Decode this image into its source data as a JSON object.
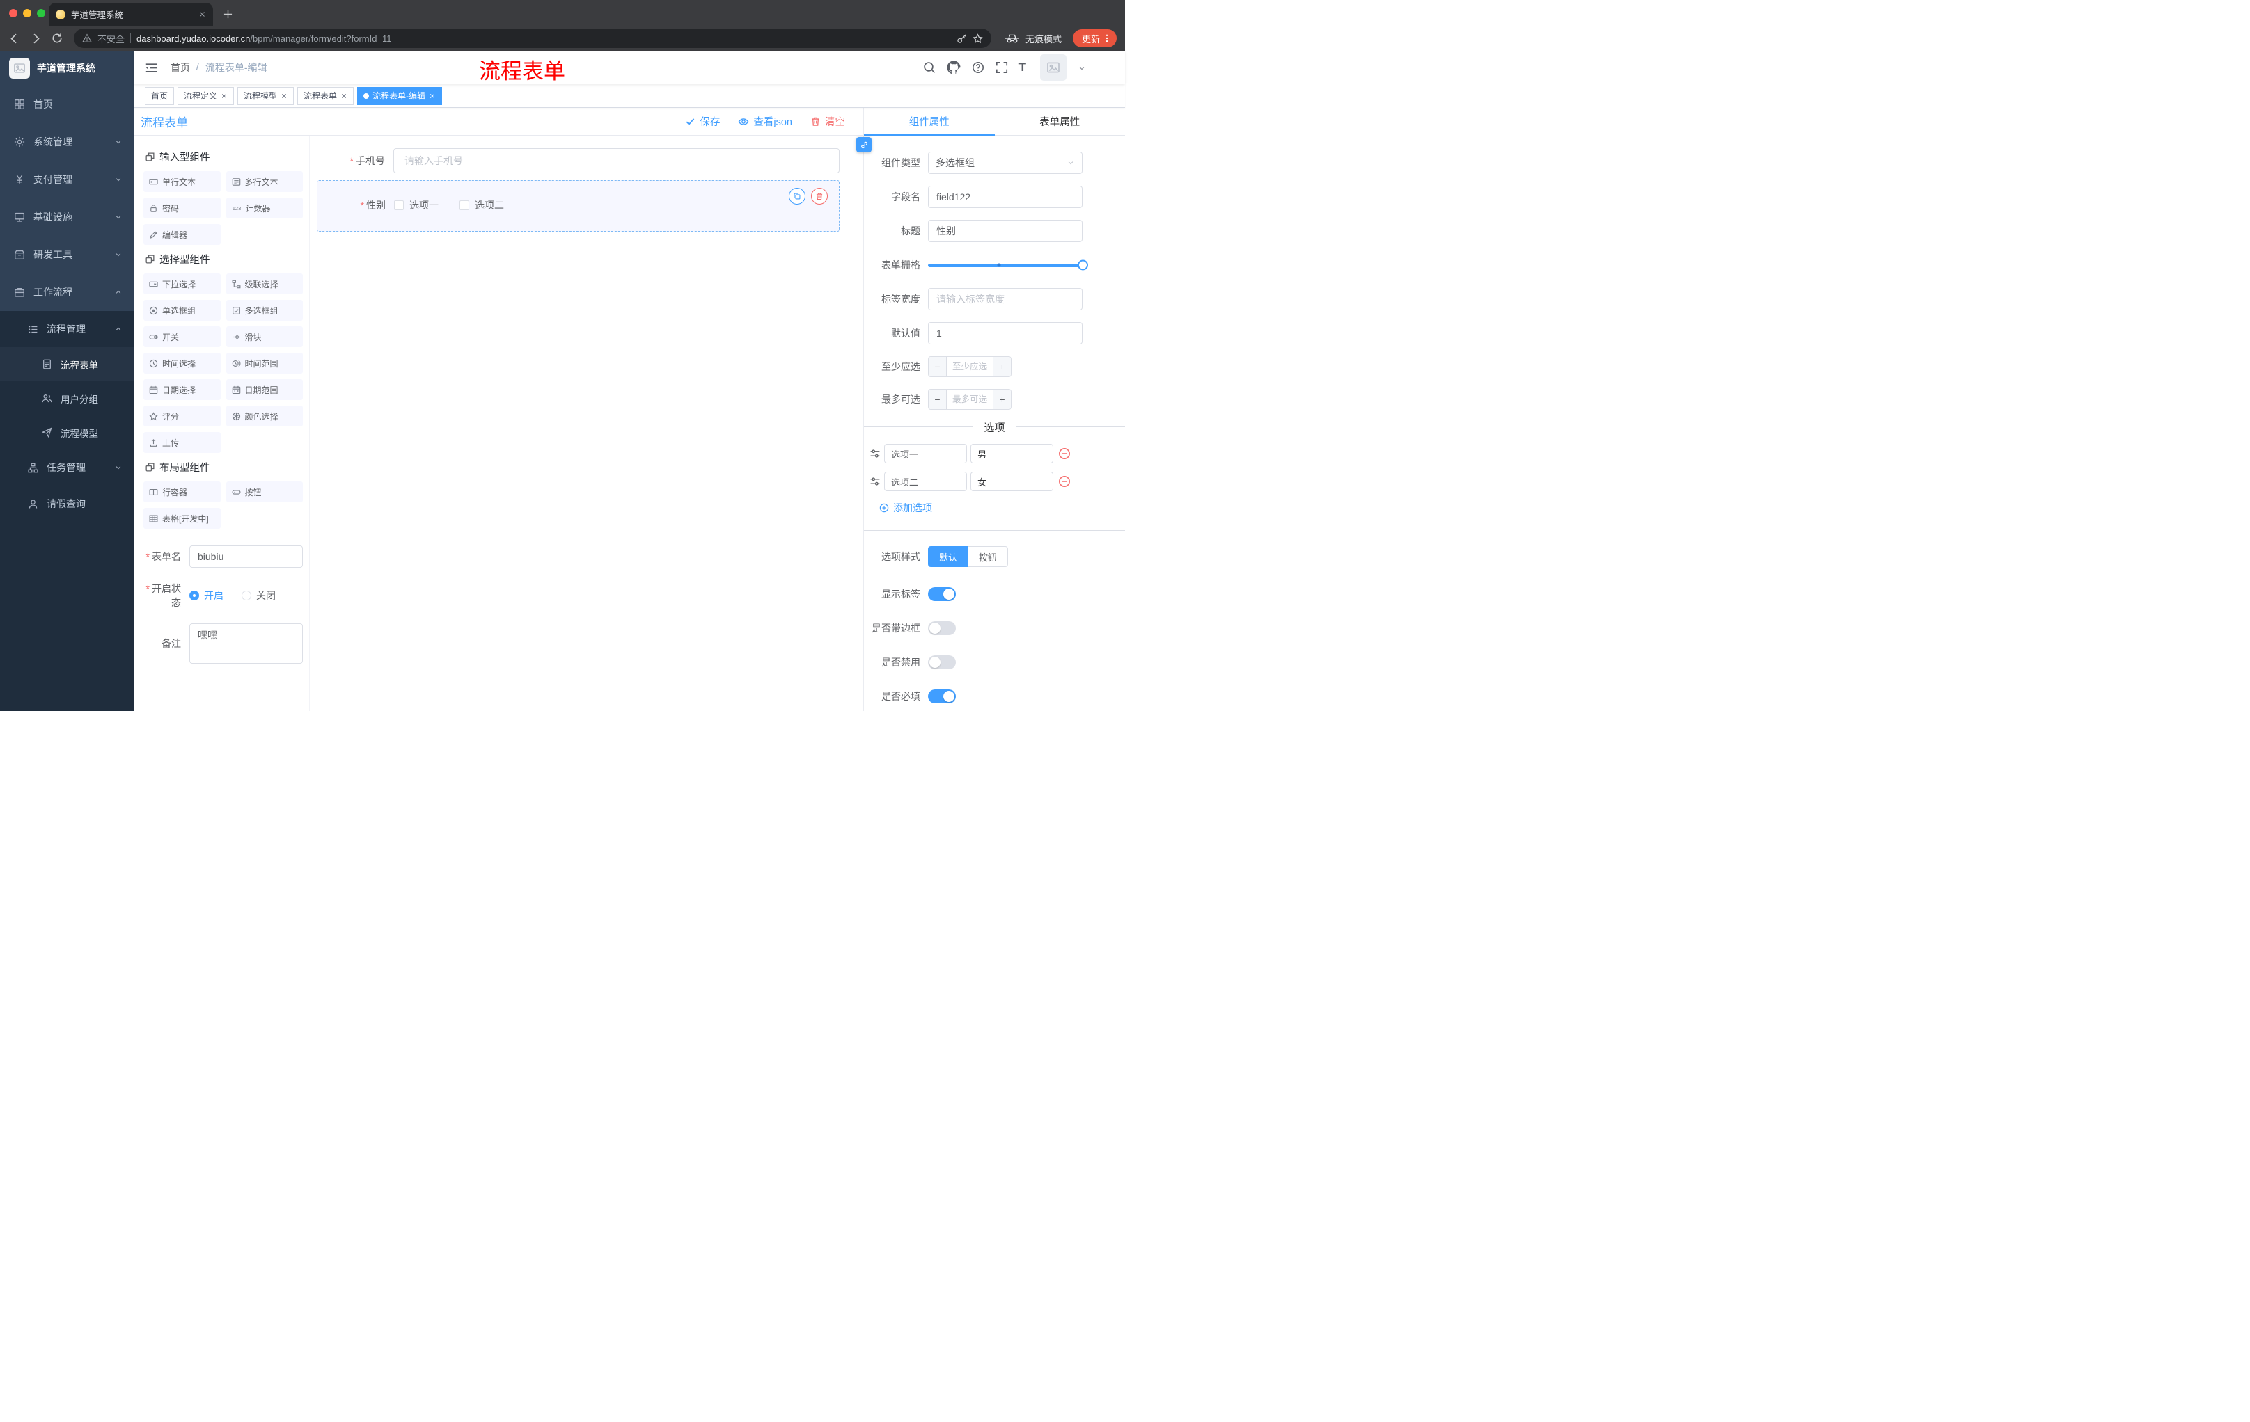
{
  "browser": {
    "tab": {
      "title": "芋道管理系统"
    },
    "address": {
      "security": "不安全",
      "domain": "dashboard.yudao.iocoder.cn",
      "path": "/bpm/manager/form/edit?formId=11"
    },
    "incognito": "无痕模式",
    "update": "更新"
  },
  "annotation": {
    "text": "流程表单"
  },
  "sidebar": {
    "logo": "芋道管理系统",
    "items": [
      {
        "label": "首页"
      },
      {
        "label": "系统管理"
      },
      {
        "label": "支付管理"
      },
      {
        "label": "基础设施"
      },
      {
        "label": "研发工具"
      },
      {
        "label": "工作流程"
      },
      {
        "label": "流程管理"
      },
      {
        "label": "流程表单"
      },
      {
        "label": "用户分组"
      },
      {
        "label": "流程模型"
      },
      {
        "label": "任务管理"
      },
      {
        "label": "请假查询"
      }
    ]
  },
  "navbar": {
    "breadcrumb_home": "首页",
    "breadcrumb_current": "流程表单-编辑"
  },
  "tags": [
    {
      "label": "首页"
    },
    {
      "label": "流程定义"
    },
    {
      "label": "流程模型"
    },
    {
      "label": "流程表单"
    },
    {
      "label": "流程表单-编辑"
    }
  ],
  "designer": {
    "title": "流程表单",
    "save": "保存",
    "view_json": "查看json",
    "clear": "清空"
  },
  "palette": {
    "groups": [
      {
        "title": "输入型组件",
        "items": [
          "单行文本",
          "多行文本",
          "密码",
          "计数器",
          "编辑器"
        ]
      },
      {
        "title": "选择型组件",
        "items": [
          "下拉选择",
          "级联选择",
          "单选框组",
          "多选框组",
          "开关",
          "滑块",
          "时间选择",
          "时间范围",
          "日期选择",
          "日期范围",
          "评分",
          "颜色选择",
          "上传"
        ]
      },
      {
        "title": "布局型组件",
        "items": [
          "行容器",
          "按钮",
          "表格[开发中]"
        ]
      }
    ],
    "form": {
      "name_label": "表单名",
      "name_value": "biubiu",
      "status_label": "开启状态",
      "status_on": "开启",
      "status_off": "关闭",
      "remark_label": "备注",
      "remark_value": "嘿嘿"
    }
  },
  "canvas": {
    "phone_label": "手机号",
    "phone_placeholder": "请输入手机号",
    "gender_label": "性别",
    "gender_options": [
      "选项一",
      "选项二"
    ]
  },
  "props": {
    "tab_component": "组件属性",
    "tab_form": "表单属性",
    "component_type_label": "组件类型",
    "component_type_value": "多选框组",
    "field_label": "字段名",
    "field_value": "field122",
    "title_label": "标题",
    "title_value": "性别",
    "grid_label": "表单栅格",
    "label_width_label": "标签宽度",
    "label_width_placeholder": "请输入标签宽度",
    "default_label": "默认值",
    "default_value": "1",
    "min_label": "至少应选",
    "min_placeholder": "至少应选",
    "max_label": "最多可选",
    "max_placeholder": "最多可选",
    "options_title": "选项",
    "options": [
      {
        "label": "选项一",
        "value": "男"
      },
      {
        "label": "选项二",
        "value": "女"
      }
    ],
    "add_option": "添加选项",
    "style_label": "选项样式",
    "style_default": "默认",
    "style_button": "按钮",
    "toggles": [
      {
        "label": "显示标签",
        "on": true
      },
      {
        "label": "是否带边框",
        "on": false
      },
      {
        "label": "是否禁用",
        "on": false
      },
      {
        "label": "是否必填",
        "on": true
      }
    ]
  },
  "colors": {
    "accent": "#409eff",
    "danger": "#f56c6c",
    "sidebar_bg": "#304156",
    "submenu_bg": "#1f2d3d",
    "annotation_red": "#fd0100",
    "update_pill": "#e9543e",
    "selected_item_bg": "#f6f7ff"
  }
}
